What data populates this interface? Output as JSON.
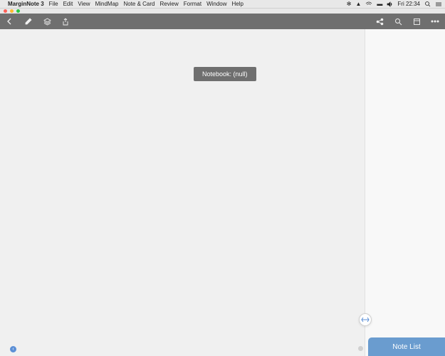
{
  "menubar": {
    "apple": "",
    "app_name": "MarginNote 3",
    "items": [
      "File",
      "Edit",
      "View",
      "MindMap",
      "Note & Card",
      "Review",
      "Format",
      "Window",
      "Help"
    ],
    "clock": "Fri 22:34"
  },
  "tooltip": {
    "text": "Notebook: (null)"
  },
  "notelist": {
    "label": "Note List"
  }
}
